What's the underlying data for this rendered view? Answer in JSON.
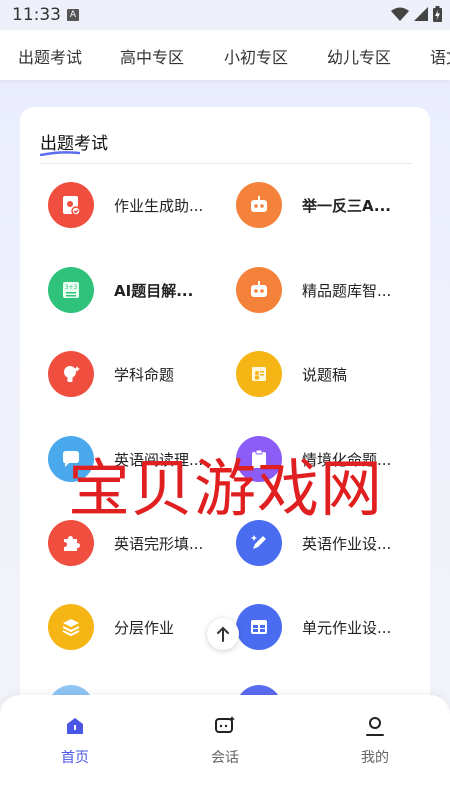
{
  "status_bar": {
    "time": "11:33",
    "notif_icon_letter": "A"
  },
  "tabs": [
    "出题考试",
    "高中专区",
    "小初专区",
    "幼儿专区",
    "语文"
  ],
  "card": {
    "title": "出题考试",
    "items": [
      {
        "label": "作业生成助...",
        "icon": "homework-book-icon",
        "color": "#f04e3e"
      },
      {
        "label": "举一反三A...",
        "icon": "robot-icon",
        "color": "#f4823a",
        "bold": true
      },
      {
        "label": "AI题目解...",
        "icon": "calculator-board-icon",
        "color": "#2fc27a",
        "bold": true
      },
      {
        "label": "精品题库智...",
        "icon": "robot-icon",
        "color": "#f4823a"
      },
      {
        "label": "学科命题",
        "icon": "lightbulb-icon",
        "color": "#f04e3e"
      },
      {
        "label": "说题稿",
        "icon": "presentation-icon",
        "color": "#f5b515"
      },
      {
        "label": "英语阅读理...",
        "icon": "chat-bubble-icon",
        "color": "#4aa8ec"
      },
      {
        "label": "情境化命题...",
        "icon": "clipboard-icon",
        "color": "#8b5cf6"
      },
      {
        "label": "英语完形填...",
        "icon": "puzzle-icon",
        "color": "#f04e3e"
      },
      {
        "label": "英语作业设...",
        "icon": "pen-sparkle-icon",
        "color": "#4a6cf0"
      },
      {
        "label": "分层作业",
        "icon": "layers-icon",
        "color": "#f5b515"
      },
      {
        "label": "单元作业设...",
        "icon": "table-icon",
        "color": "#4a6cf0"
      }
    ]
  },
  "watermark": "宝贝游戏网",
  "bottom_nav": [
    {
      "label": "首页",
      "icon": "home-icon",
      "active": true
    },
    {
      "label": "会话",
      "icon": "chat-sparkle-icon",
      "active": false
    },
    {
      "label": "我的",
      "icon": "user-icon",
      "active": false
    }
  ],
  "colors": {
    "accent": "#4a57e6",
    "watermark": "#e02020"
  }
}
